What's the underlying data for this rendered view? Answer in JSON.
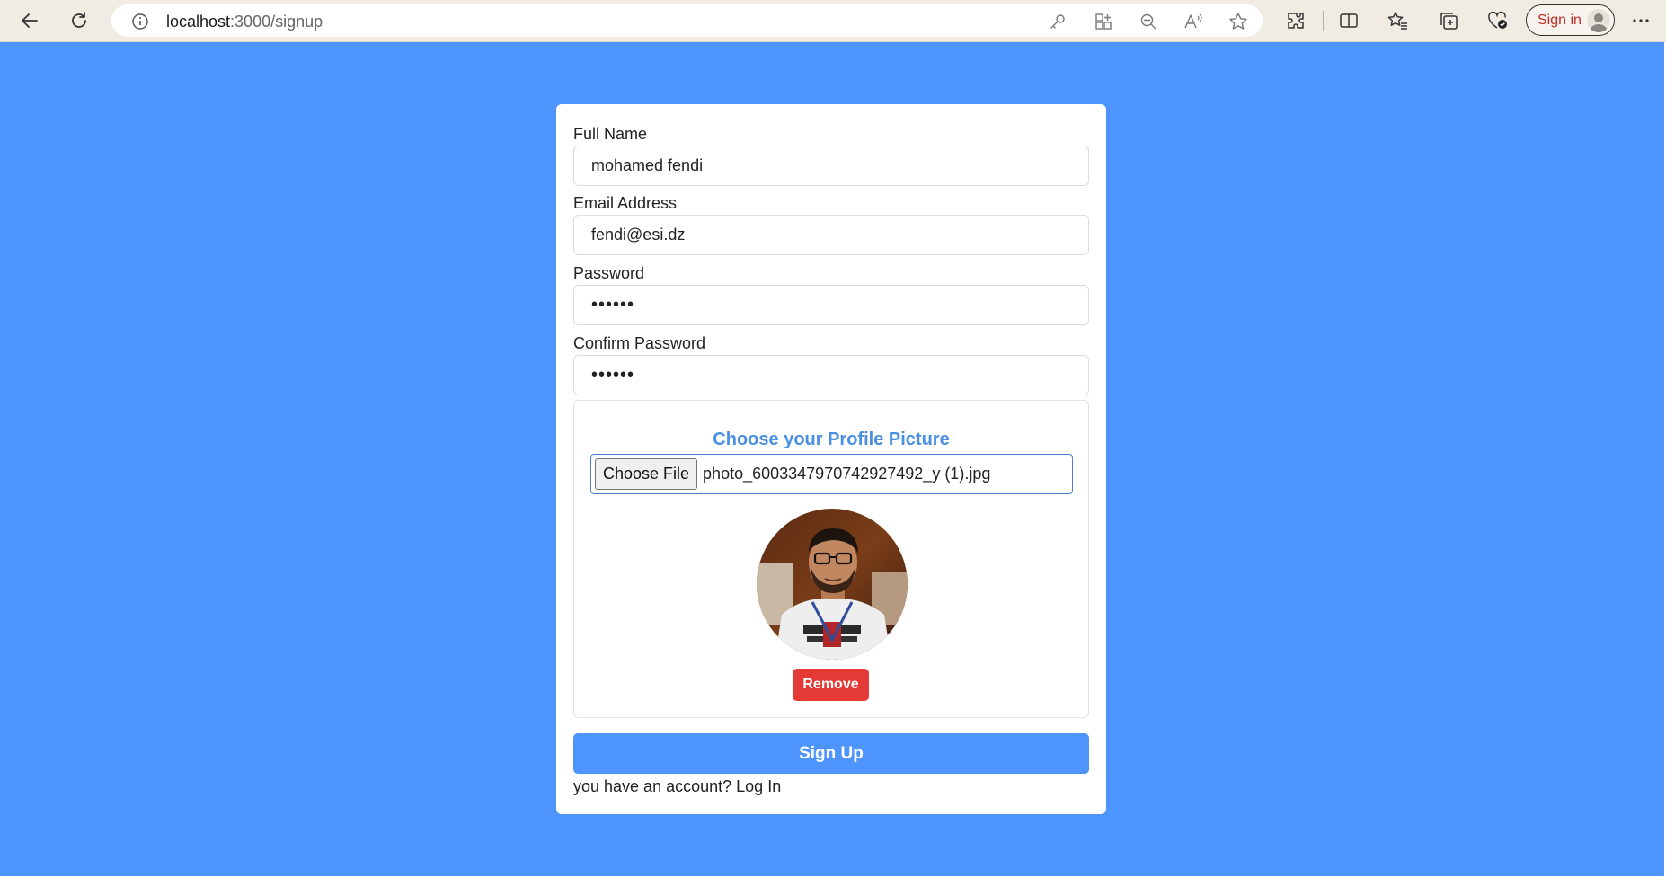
{
  "browser": {
    "url_host": "localhost",
    "url_path": ":3000/signup",
    "signin_label": "Sign in"
  },
  "form": {
    "full_name": {
      "label": "Full Name",
      "value": "mohamed fendi"
    },
    "email": {
      "label": "Email Address",
      "value": "fendi@esi.dz"
    },
    "password": {
      "label": "Password",
      "value": "••••••"
    },
    "confirm_password": {
      "label": "Confirm Password",
      "value": "••••••"
    },
    "profile_picture": {
      "title": "Choose your Profile Picture",
      "choose_button": "Choose File",
      "file_name": "photo_6003347970742927492_y (1).jpg",
      "remove_button": "Remove"
    },
    "submit_button": "Sign Up",
    "footer_prefix": "you have an account?",
    "login_link": "Log In"
  },
  "colors": {
    "page_background": "#4e94fd",
    "accent": "#4a90e2",
    "danger": "#e53935",
    "signin_text": "#c42b1c"
  },
  "icons": [
    "back-icon",
    "refresh-icon",
    "info-icon",
    "key-icon",
    "apps-icon",
    "zoom-out-icon",
    "read-aloud-icon",
    "favorite-star-icon",
    "extensions-icon",
    "split-screen-icon",
    "favorites-icon",
    "collections-icon",
    "browser-essentials-icon",
    "profile-icon",
    "more-icon"
  ]
}
